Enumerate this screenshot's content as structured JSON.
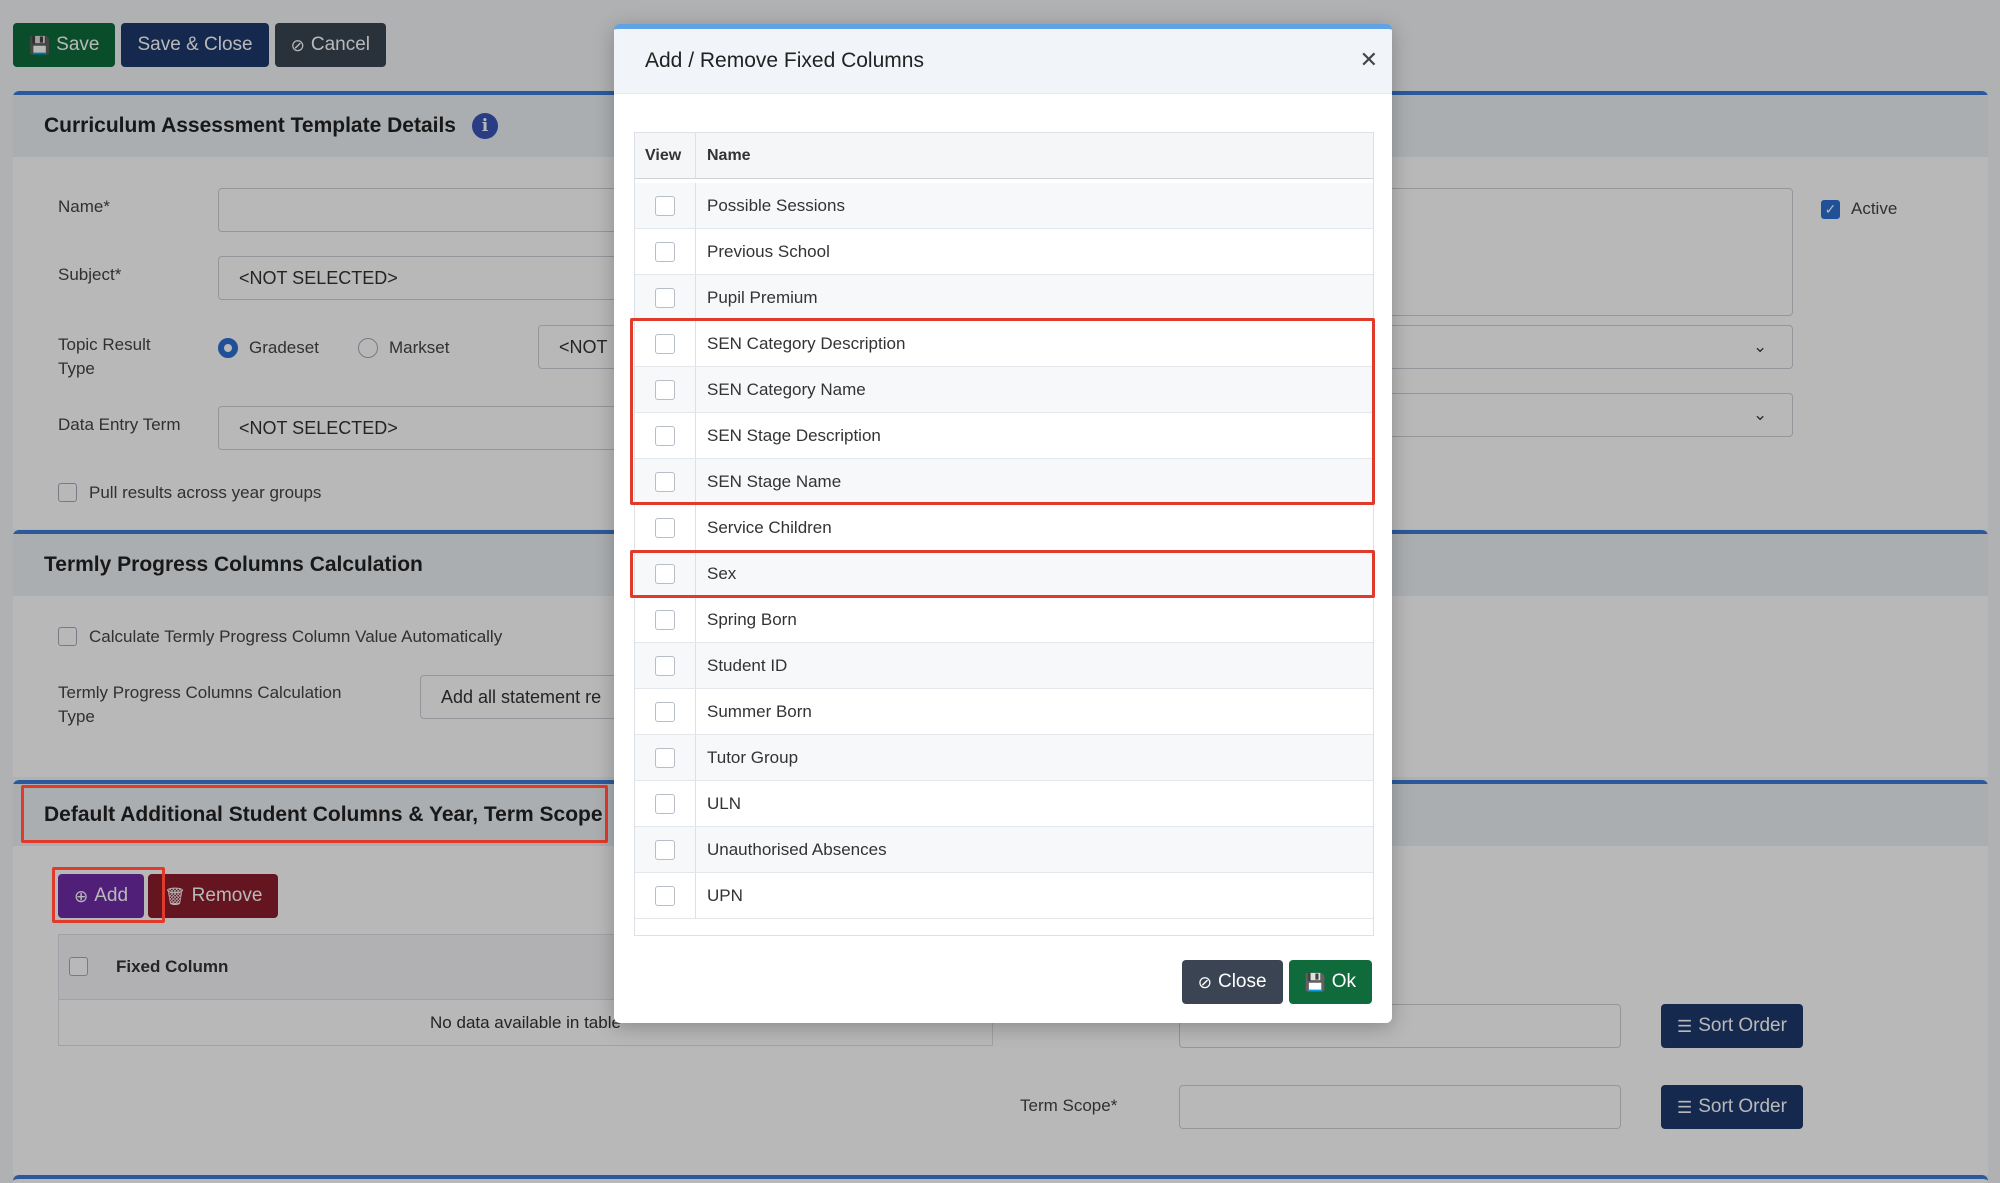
{
  "toolbar": {
    "save": "Save",
    "save_close": "Save & Close",
    "cancel": "Cancel"
  },
  "card1": {
    "title": "Curriculum Assessment Template Details",
    "name_label": "Name*",
    "subject_label": "Subject*",
    "subject_value": "<NOT SELECTED>",
    "topic_label": "Topic Result Type",
    "radio_gradeset": "Gradeset",
    "radio_markset": "Markset",
    "topic_select_value": "<NOT",
    "data_entry_label": "Data Entry Term",
    "data_entry_value": "<NOT SELECTED>",
    "pull_results": "Pull results across year groups",
    "active_label": "Active"
  },
  "card2": {
    "title": "Termly Progress Columns Calculation",
    "calc_auto": "Calculate Termly Progress Column Value Automatically",
    "calc_type_label": "Termly Progress Columns Calculation Type",
    "calc_type_value": "Add all statement re"
  },
  "card3": {
    "title": "Default Additional Student Columns & Year, Term Scope",
    "add": "Add",
    "remove": "Remove",
    "fixed_column": "Fixed Column",
    "no_data": "No data available in table",
    "term_scope_label": "Term Scope*",
    "sort_order": "Sort Order"
  },
  "modal": {
    "title": "Add / Remove Fixed Columns",
    "col_view": "View",
    "col_name": "Name",
    "rows": [
      "Possible Sessions",
      "Previous School",
      "Pupil Premium",
      "SEN Category Description",
      "SEN Category Name",
      "SEN Stage Description",
      "SEN Stage Name",
      "Service Children",
      "Sex",
      "Spring Born",
      "Student ID",
      "Summer Born",
      "Tutor Group",
      "ULN",
      "Unauthorised Absences",
      "UPN"
    ],
    "close": "Close",
    "ok": "Ok"
  },
  "colors": {
    "save": "#0f6b3c",
    "navy": "#1e3a6e",
    "highlight": "#e03a2b",
    "add": "#6f2da8",
    "remove": "#8b1e2d"
  }
}
